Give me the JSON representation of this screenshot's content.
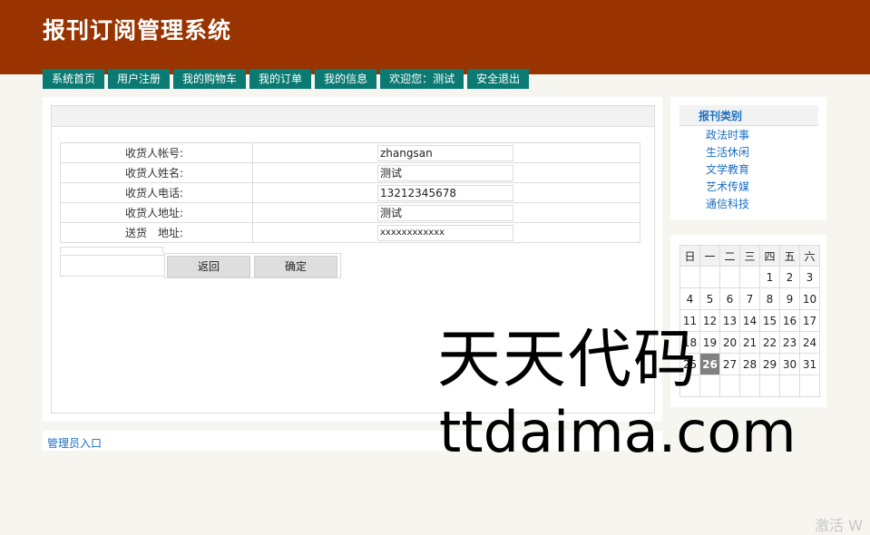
{
  "header": {
    "title": "报刊订阅管理系统"
  },
  "nav": [
    {
      "label": "系统首页"
    },
    {
      "label": "用户注册"
    },
    {
      "label": "我的购物车"
    },
    {
      "label": "我的订单"
    },
    {
      "label": "我的信息"
    },
    {
      "label": "欢迎您：测试"
    },
    {
      "label": "安全退出"
    }
  ],
  "form": {
    "rows": [
      {
        "label": "收货人帐号:",
        "value": "zhangsan"
      },
      {
        "label": "收货人姓名:",
        "value": "测试"
      },
      {
        "label": "收货人电话:",
        "value": "13212345678"
      },
      {
        "label": "收货人地址:",
        "value": "测试"
      },
      {
        "label": "送货　地址:",
        "value": "xxxxxxxxxxxx"
      }
    ],
    "back_label": "返回",
    "confirm_label": "确定"
  },
  "footer": {
    "admin_link": "管理员入口"
  },
  "sidebar": {
    "category_title": "报刊类别",
    "categories": [
      "政法时事",
      "生活休闲",
      "文学教育",
      "艺术传媒",
      "通信科技"
    ]
  },
  "calendar": {
    "weekdays": [
      "日",
      "一",
      "二",
      "三",
      "四",
      "五",
      "六"
    ],
    "weeks": [
      [
        "",
        "",
        "",
        "",
        "1",
        "2",
        "3"
      ],
      [
        "4",
        "5",
        "6",
        "7",
        "8",
        "9",
        "10"
      ],
      [
        "11",
        "12",
        "13",
        "14",
        "15",
        "16",
        "17"
      ],
      [
        "18",
        "19",
        "20",
        "21",
        "22",
        "23",
        "24"
      ],
      [
        "25",
        "26",
        "27",
        "28",
        "29",
        "30",
        "31"
      ],
      [
        "",
        "",
        "",
        "",
        "",
        "",
        ""
      ]
    ],
    "today": "26"
  },
  "watermark": {
    "cn": "天天代码",
    "en": "ttdaima.com"
  },
  "activation_text": "激活 W"
}
